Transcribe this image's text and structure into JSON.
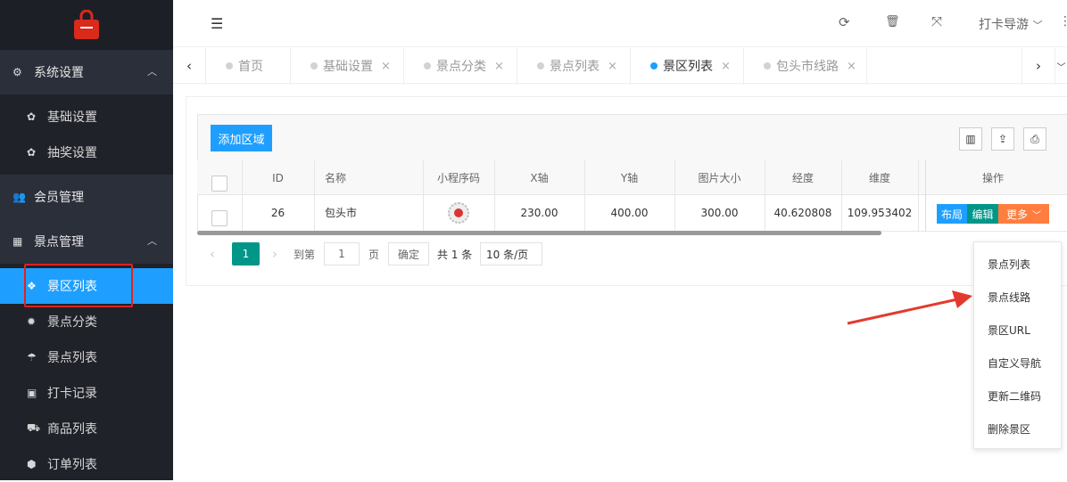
{
  "sidebar": {
    "logo_icon": "shopping-bag-icon",
    "groups": [
      {
        "label": "系统设置",
        "icon": "gears-icon"
      },
      {
        "label": "会员管理",
        "icon": "users-icon"
      },
      {
        "label": "景点管理",
        "icon": "grid-icon"
      }
    ],
    "items": [
      {
        "label": "基础设置",
        "icon": "gear-icon"
      },
      {
        "label": "抽奖设置",
        "icon": "gear-icon"
      },
      {
        "label": "景区列表",
        "icon": "cubes-icon"
      },
      {
        "label": "景点分类",
        "icon": "sun-icon"
      },
      {
        "label": "景点列表",
        "icon": "umbrella-icon"
      },
      {
        "label": "打卡记录",
        "icon": "address-book-icon"
      },
      {
        "label": "商品列表",
        "icon": "truck-icon"
      },
      {
        "label": "订单列表",
        "icon": "cube-icon"
      }
    ]
  },
  "header": {
    "user": "打卡导游"
  },
  "tabs": [
    "首页",
    "基础设置",
    "景点分类",
    "景点列表",
    "景区列表",
    "包头市线路"
  ],
  "toolbar": {
    "add_label": "添加区域"
  },
  "table": {
    "columns": [
      "ID",
      "名称",
      "小程序码",
      "X轴",
      "Y轴",
      "图片大小",
      "经度",
      "维度",
      "操作"
    ],
    "rows": [
      {
        "id": "26",
        "name": "包头市",
        "x": "230.00",
        "y": "400.00",
        "size": "300.00",
        "lng": "40.620808",
        "lat": "109.953402"
      }
    ],
    "actions": {
      "layout": "布局",
      "edit": "编辑",
      "more": "更多"
    }
  },
  "pager": {
    "current": "1",
    "goto_label": "到第",
    "page_input": "1",
    "page_unit": "页",
    "confirm": "确定",
    "total": "共 1 条",
    "per_page": "10 条/页"
  },
  "dropdown": [
    "景点列表",
    "景点线路",
    "景区URL",
    "自定义导航",
    "更新二维码",
    "删除景区"
  ],
  "colors": {
    "accent": "#1e9fff",
    "green": "#009688",
    "orange": "#ff7e3f",
    "sidebar": "#20222a",
    "highlight": "#e02222"
  }
}
